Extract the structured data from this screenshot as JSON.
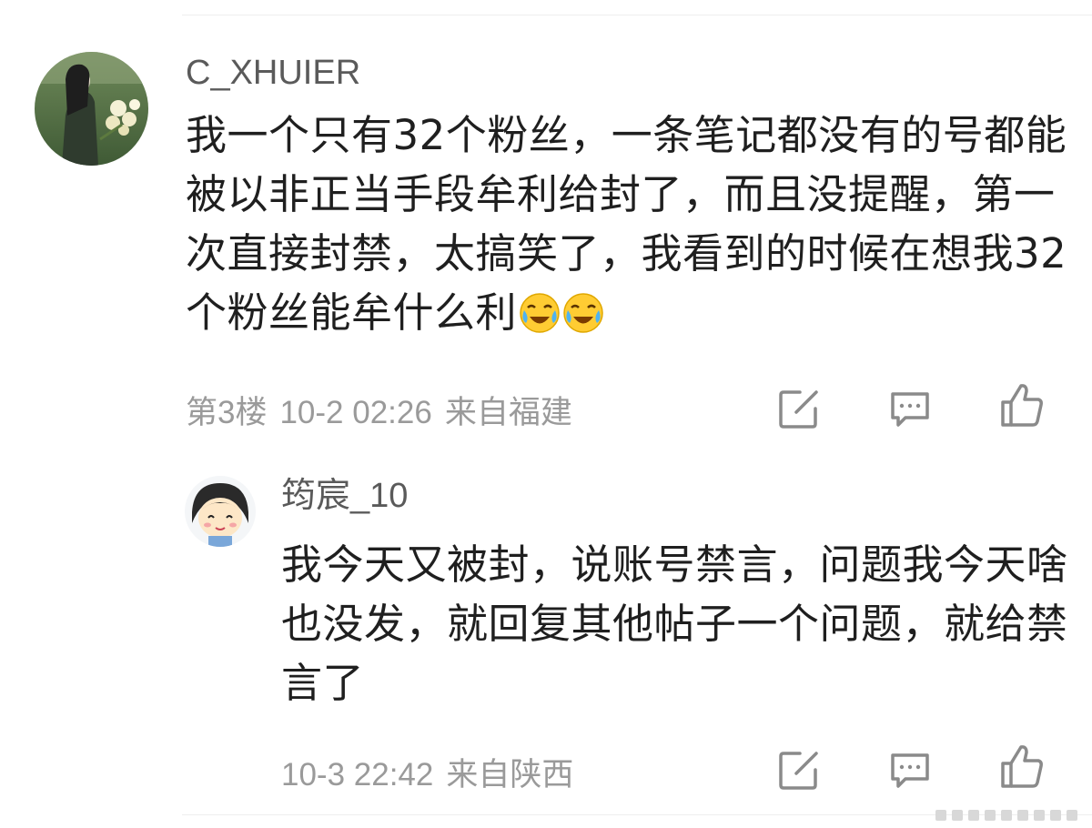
{
  "main_comment": {
    "username": "C_XHUIER",
    "content": "我一个只有32个粉丝，一条笔记都没有的号都能被以非正当手段牟利给封了，而且没提醒，第一次直接封禁，太搞笑了，我看到的时候在想我32个粉丝能牟什么利",
    "emojis": [
      "laugh-cry-emoji",
      "laugh-cry-emoji"
    ],
    "floor": "第3楼",
    "time": "10-2 02:26",
    "location": "来自福建",
    "actions": [
      "share-icon",
      "comment-icon",
      "like-icon"
    ]
  },
  "reply_comment": {
    "username": "筠宸_10",
    "content": "我今天又被封，说账号禁言，问题我今天啥也没发，就回复其他帖子一个问题，就给禁言了",
    "time": "10-3 22:42",
    "location": "来自陕西",
    "actions": [
      "share-icon",
      "comment-icon",
      "like-icon"
    ]
  },
  "colors": {
    "text": "#1f1f1f",
    "username": "#5a5a5a",
    "meta": "#9a9a9a",
    "icon": "#8a8a8a",
    "divider": "#eeeeee"
  }
}
